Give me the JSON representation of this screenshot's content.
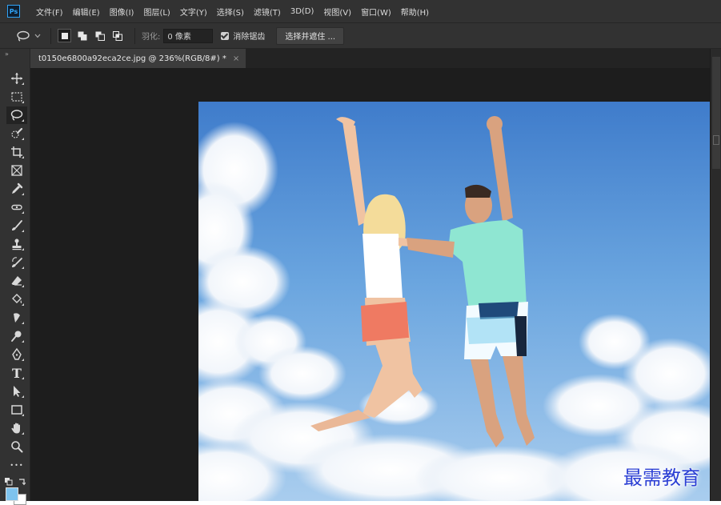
{
  "app": {
    "logo_text": "Ps",
    "accent": "#31a8ff"
  },
  "menu": [
    "文件(F)",
    "编辑(E)",
    "图像(I)",
    "图层(L)",
    "文字(Y)",
    "选择(S)",
    "滤镜(T)",
    "3D(D)",
    "视图(V)",
    "窗口(W)",
    "帮助(H)"
  ],
  "options": {
    "tool_icon": "lasso-icon",
    "feather_label": "羽化:",
    "feather_value": "0 像素",
    "antialias_label": "消除锯齿",
    "antialias_checked": true,
    "select_mask_label": "选择并遮住 ..."
  },
  "document": {
    "tab_title": "t0150e6800a92eca2ce.jpg @ 236%(RGB/8#) *",
    "close_glyph": "×"
  },
  "toolbar": {
    "collapse_glyph": "»",
    "tools": [
      "move-icon",
      "marquee-icon",
      "lasso-icon",
      "quick-select-icon",
      "crop-icon",
      "frame-icon",
      "eyedropper-icon",
      "healing-brush-icon",
      "brush-icon",
      "clone-stamp-icon",
      "history-brush-icon",
      "eraser-icon",
      "paint-bucket-icon",
      "smudge-icon",
      "dodge-icon",
      "pen-icon",
      "type-icon",
      "path-select-icon",
      "rectangle-icon",
      "hand-icon",
      "zoom-icon",
      "more-tools-icon"
    ],
    "active_tool": "lasso-icon",
    "type_glyph": "T",
    "more_glyph": "•••",
    "foreground_color": "#7ec3ee",
    "background_color": "#ffffff"
  },
  "watermark": {
    "text": "最需教育",
    "color": "#2b3fd4"
  }
}
